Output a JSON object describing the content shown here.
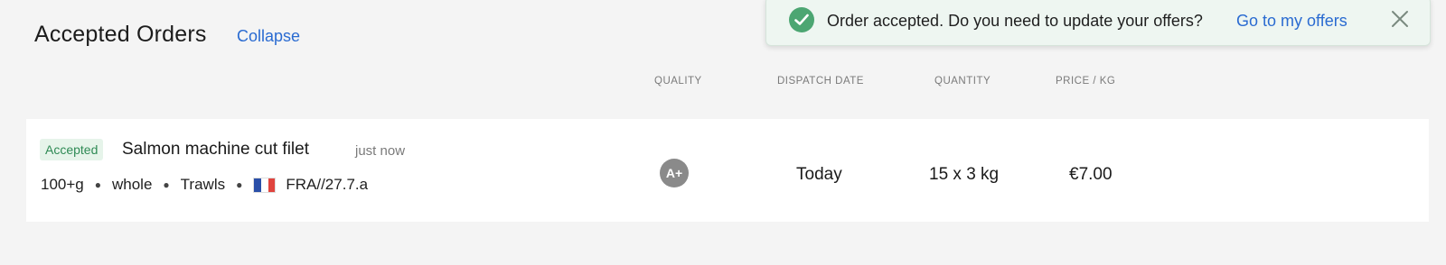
{
  "header": {
    "title": "Accepted Orders",
    "collapse_label": "Collapse"
  },
  "toast": {
    "message": "Order accepted. Do you need to update your offers?",
    "link_label": "Go to my offers",
    "success_icon": "check-circle-icon",
    "close_icon": "close-icon"
  },
  "columns": {
    "quality": "QUALITY",
    "dispatch_date": "DISPATCH DATE",
    "quantity": "QUANTITY",
    "price": "PRICE / KG"
  },
  "order": {
    "status": "Accepted",
    "product": "Salmon machine cut filet",
    "time": "just now",
    "size": "100+g",
    "cut": "whole",
    "method": "Trawls",
    "flag_icon": "france-flag-icon",
    "origin": "FRA//27.7.a",
    "quality": "A+",
    "dispatch": "Today",
    "quantity": "15 x 3 kg",
    "price": "€7.00"
  },
  "colors": {
    "accent": "#2a6bd1",
    "success": "#4ca672",
    "badge_bg": "#e6f4ea",
    "badge_text": "#2f8a55"
  }
}
